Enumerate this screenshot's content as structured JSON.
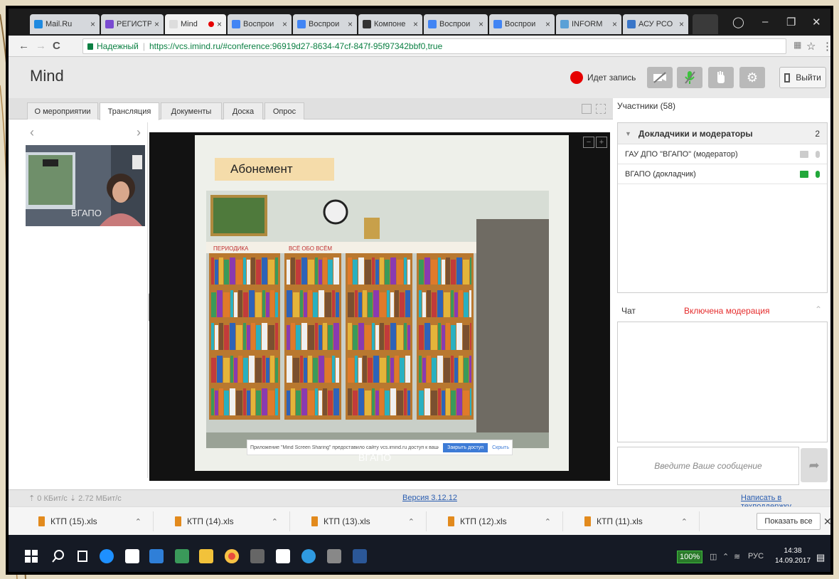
{
  "browser": {
    "tabs": [
      {
        "label": "Mail.Ru",
        "color": "#1f8ae0"
      },
      {
        "label": "РЕГИСТР",
        "color": "#7a4bd1"
      },
      {
        "label": "Mind",
        "color": "#dddddd",
        "active": true
      },
      {
        "label": "Воспрои",
        "color": "#4285f4"
      },
      {
        "label": "Воспрои",
        "color": "#4285f4"
      },
      {
        "label": "Компоне",
        "color": "#333333"
      },
      {
        "label": "Воспрои",
        "color": "#4285f4"
      },
      {
        "label": "Воспрои",
        "color": "#4285f4"
      },
      {
        "label": "INFORM",
        "color": "#5aa0d6"
      },
      {
        "label": "АСУ РСО",
        "color": "#3a76c8"
      }
    ],
    "tab_close": "×",
    "address": {
      "secure_label": "Надежный",
      "url": "https://vcs.imind.ru/#conference:96919d27-8634-47cf-847f-95f97342bbf0,true"
    }
  },
  "app": {
    "logo": "Mind",
    "recording_label": "Идет запись",
    "exit_label": "Выйти",
    "tabs": [
      "О мероприятии",
      "Трансляция",
      "Документы",
      "Доска",
      "Опрос"
    ],
    "active_tab": 1,
    "participants_header": "Участники (58)"
  },
  "video": {
    "thumb_label": "ВГАПО",
    "slide_title": "Абонемент",
    "slide_caption": "ВГАПО",
    "notification": "Приложение \"Mind Screen Sharing\" предоставило сайту vcs.imind.ru доступ к вашему экрану.",
    "notification_primary": "Закрыть доступ",
    "notification_secondary": "Скрыть",
    "book_signs": [
      "ПЕРИОДИКА",
      "ВСЁ ОБО ВСЁМ"
    ]
  },
  "participants": {
    "group_label": "Докладчики и модераторы",
    "group_count": "2",
    "rows": [
      {
        "name": "ГАУ ДПО \"ВГАПО\" (модератор)",
        "cam_color": "#cccccc",
        "mic_color": "#cccccc"
      },
      {
        "name": "ВГАПО (докладчик)",
        "cam_color": "#22a83a",
        "mic_color": "#22a83a"
      }
    ]
  },
  "chat": {
    "label": "Чат",
    "moderation_label": "Включена модерация",
    "input_placeholder": "Введите Ваше сообщение"
  },
  "status": {
    "bitrate": "⇡ 0 КБит/с  ⇣ 2.72 МБит/с",
    "version": "Версия 3.12.12",
    "support": "Написать в техподдержку"
  },
  "downloads": {
    "files": [
      "КТП (15).xls",
      "КТП (14).xls",
      "КТП (13).xls",
      "КТП (12).xls",
      "КТП (11).xls"
    ],
    "show_all": "Показать все"
  },
  "taskbar": {
    "battery": "100%",
    "lang": "РУС",
    "time": "14:38",
    "date": "14.09.2017"
  },
  "colors": {
    "accent_blue": "#2a5db0",
    "record_red": "#e60000",
    "moderation_red": "#e52b2b",
    "active_green": "#22a83a"
  }
}
